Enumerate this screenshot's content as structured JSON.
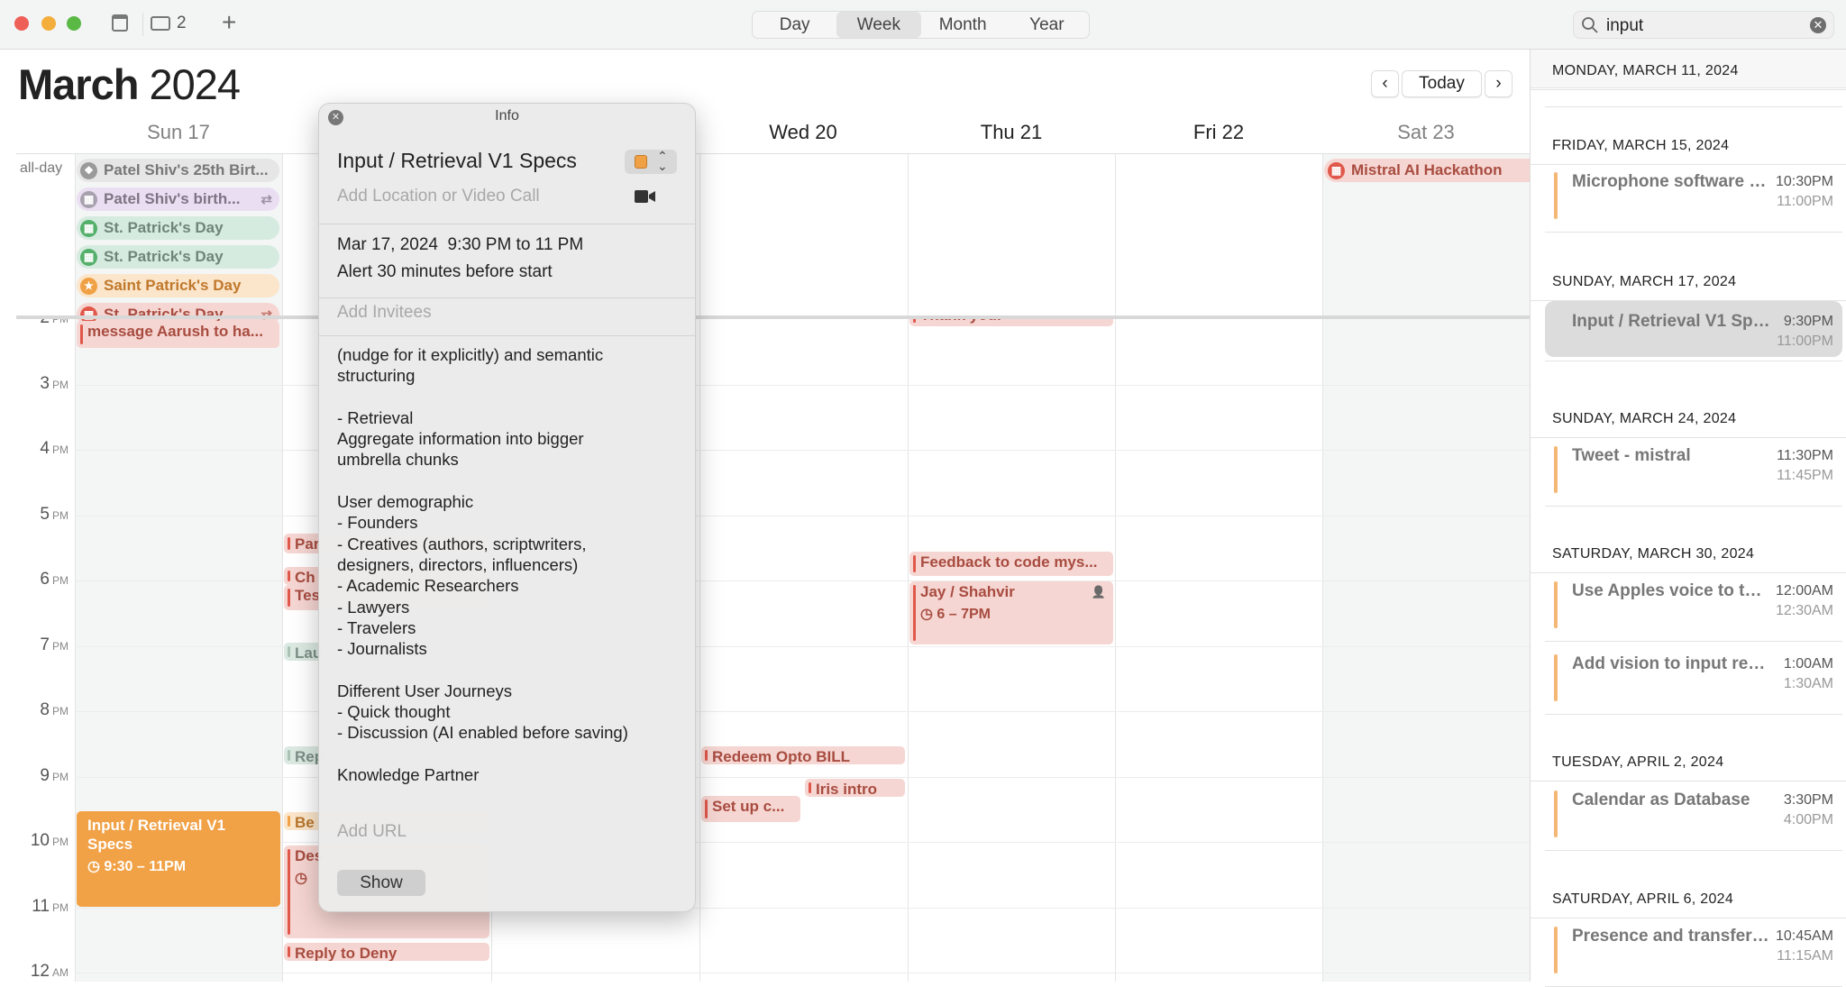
{
  "toolbar": {
    "inbox_count": "2",
    "views": [
      "Day",
      "Week",
      "Month",
      "Year"
    ],
    "active_view": "Week",
    "search_value": "input"
  },
  "header": {
    "month": "March",
    "year": "2024",
    "today_label": "Today"
  },
  "days": [
    "Sun 17",
    "",
    "",
    "Wed 20",
    "Thu 21",
    "Fri 22",
    "Sat 23"
  ],
  "all_day_label": "all-day",
  "all_day_events": [
    {
      "title": "Patel Shiv's 25th Birt...",
      "icon": "gift-icon",
      "color": "#9a9a9a",
      "bg": "#e6e6e6",
      "text": "#777777"
    },
    {
      "title": "Patel Shiv's birth...",
      "icon": "calendar-icon",
      "color": "#a7a0ad",
      "bg": "#eadff2",
      "text": "#7d7484",
      "repeat": true
    },
    {
      "title": "St. Patrick's Day",
      "icon": "calendar-icon",
      "color": "#54b06a",
      "bg": "#d6ebe0",
      "text": "#6e8679"
    },
    {
      "title": "St. Patrick's Day",
      "icon": "calendar-icon",
      "color": "#54b06a",
      "bg": "#d6ebe0",
      "text": "#6e8679"
    },
    {
      "title": "Saint Patrick's Day",
      "icon": "star-icon",
      "color": "#f0a145",
      "bg": "#fbe6cb",
      "text": "#c0782c"
    },
    {
      "title": "St. Patrick's Day",
      "icon": "calendar-icon",
      "color": "#e0584a",
      "bg": "#f6d6d2",
      "text": "#a84c40",
      "repeat": true
    }
  ],
  "sat_all_day": {
    "title": "Mistral AI Hackathon",
    "icon": "calendar-icon",
    "color": "#e0584a"
  },
  "hours": [
    {
      "h": "2",
      "p": "PM"
    },
    {
      "h": "3",
      "p": "PM"
    },
    {
      "h": "4",
      "p": "PM"
    },
    {
      "h": "5",
      "p": "PM"
    },
    {
      "h": "6",
      "p": "PM"
    },
    {
      "h": "7",
      "p": "PM"
    },
    {
      "h": "8",
      "p": "PM"
    },
    {
      "h": "9",
      "p": "PM"
    },
    {
      "h": "10",
      "p": "PM"
    },
    {
      "h": "11",
      "p": "PM"
    },
    {
      "h": "12",
      "p": "AM"
    }
  ],
  "events": [
    {
      "title": "message Aarush to ha...",
      "style": "pink"
    },
    {
      "title": "Input / Retrieval V1 Specs",
      "time": "9:30 – 11PM",
      "style": "orange"
    },
    {
      "title": "Par",
      "style": "pink"
    },
    {
      "title": "Ch",
      "style": "pink"
    },
    {
      "title": "Tes",
      "style": "pink"
    },
    {
      "title": "Lau",
      "style": "green"
    },
    {
      "title": "Rep",
      "style": "green"
    },
    {
      "title": "Be",
      "style": "lorange"
    },
    {
      "title": "Des",
      "style": "pink"
    },
    {
      "title": "Reply to Deny",
      "style": "pink"
    },
    {
      "title": "Redeem Opto BILL",
      "style": "pink"
    },
    {
      "title": "Iris intro",
      "style": "pink"
    },
    {
      "title": "Set up c...",
      "style": "pink"
    },
    {
      "title": "Thank you.",
      "style": "pink"
    },
    {
      "title": "Feedback to code mys...",
      "style": "pink"
    },
    {
      "title": "Jay / Shahvir",
      "time": "6 – 7PM",
      "style": "pink",
      "invitee": true
    }
  ],
  "popover": {
    "header": "Info",
    "title": "Input / Retrieval V1 Specs",
    "calendar_color": "#f0a145",
    "location_placeholder": "Add Location or Video Call",
    "date_line": "Mar 17, 2024  9:30 PM to 11 PM",
    "alert_line": "Alert 30 minutes before start",
    "invitees_placeholder": "Add Invitees",
    "notes": "(nudge for it explicitly) and semantic\nstructuring\n\n- Retrieval\nAggregate information into bigger\numbrella chunks\n\nUser demographic\n- Founders\n- Creatives (authors, scriptwriters,\ndesigners, directors, influencers)\n- Academic Researchers\n- Lawyers\n- Travelers\n- Journalists\n\nDifferent User Journeys\n- Quick thought\n- Discussion (AI enabled before saving)\n\nKnowledge Partner",
    "url_placeholder": "Add URL",
    "show_label": "Show"
  },
  "search_results": [
    {
      "date": "MONDAY, MARCH 11, 2024",
      "items": []
    },
    {
      "date": "FRIDAY, MARCH 15, 2024",
      "items": [
        {
          "title": "Microphone software a...",
          "start": "10:30PM",
          "end": "11:00PM"
        }
      ]
    },
    {
      "date": "SUNDAY, MARCH 17, 2024",
      "items": [
        {
          "title": "Input / Retrieval V1 Specs",
          "start": "9:30PM",
          "end": "11:00PM",
          "selected": true
        }
      ]
    },
    {
      "date": "SUNDAY, MARCH 24, 2024",
      "items": [
        {
          "title": "Tweet - mistral",
          "start": "11:30PM",
          "end": "11:45PM"
        }
      ]
    },
    {
      "date": "SATURDAY, MARCH 30, 2024",
      "items": [
        {
          "title": "Use Apples voice to tex...",
          "start": "12:00AM",
          "end": "12:30AM"
        },
        {
          "title": "Add vision to input retrie...",
          "start": "1:00AM",
          "end": "1:30AM"
        }
      ]
    },
    {
      "date": "TUESDAY, APRIL 2, 2024",
      "items": [
        {
          "title": "Calendar as Database",
          "start": "3:30PM",
          "end": "4:00PM"
        }
      ]
    },
    {
      "date": "SATURDAY, APRIL 6, 2024",
      "items": [
        {
          "title": "Presence and transfer o...",
          "start": "10:45AM",
          "end": "11:15AM"
        }
      ]
    }
  ]
}
